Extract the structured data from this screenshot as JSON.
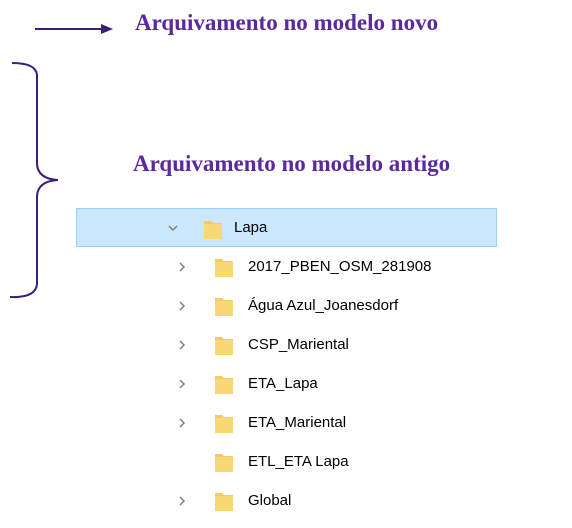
{
  "annotations": {
    "new_model": "Arquivamento no modelo novo",
    "old_model": "Arquivamento no modelo antigo",
    "color": "#5b2a9a"
  },
  "tree": {
    "root": {
      "label": "Lapa",
      "expanded": true,
      "selected": true,
      "icon": "folder-icon"
    },
    "children": [
      {
        "label": "2017_PBEN_OSM_281908",
        "has_children": true
      },
      {
        "label": "Água Azul_Joanesdorf",
        "has_children": true
      },
      {
        "label": "CSP_Mariental",
        "has_children": true
      },
      {
        "label": "ETA_Lapa",
        "has_children": true
      },
      {
        "label": "ETA_Mariental",
        "has_children": true
      },
      {
        "label": "ETL_ETA Lapa",
        "has_children": false
      },
      {
        "label": "Global",
        "has_children": true
      }
    ]
  },
  "colors": {
    "selection_bg": "#cce8ff",
    "selection_border": "#99d1ff",
    "folder": "#f3c969",
    "chevron": "#808080"
  }
}
